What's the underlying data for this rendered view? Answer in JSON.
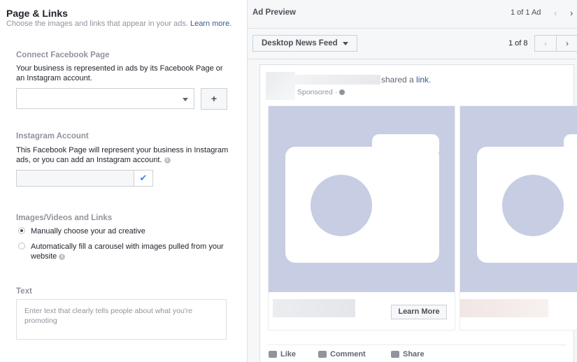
{
  "left": {
    "title": "Page & Links",
    "subtitle": "Choose the images and links that appear in your ads.",
    "learn_more": "Learn more.",
    "connect": {
      "label": "Connect Facebook Page",
      "desc": "Your business is represented in ads by its Facebook Page or an Instagram account.",
      "plus": "+"
    },
    "instagram": {
      "label": "Instagram Account",
      "desc": "This Facebook Page will represent your business in Instagram ads, or you can add an Instagram account.",
      "info": "i"
    },
    "media": {
      "label": "Images/Videos and Links",
      "option1": "Manually choose your ad creative",
      "option2_line1": "Automatically fill a carousel with images pulled from your",
      "option2_line2": "website",
      "info": "i"
    },
    "text": {
      "label": "Text",
      "placeholder": "Enter text that clearly tells people about what you're promoting"
    }
  },
  "right": {
    "title": "Ad Preview",
    "ad_count": "1 of 1 Ad",
    "prev_arrow": "‹",
    "next_arrow": "›",
    "placement": "Desktop News Feed",
    "page_count": "1 of 8",
    "card": {
      "shared_prefix": "shared a",
      "shared_link": "link",
      "shared_suffix": ".",
      "sponsored": "Sponsored ·",
      "learn_more_btn": "Learn More",
      "like": "Like",
      "comment": "Comment",
      "share": "Share"
    }
  },
  "colors": {
    "link": "#365899",
    "image_placeholder": "#c7cde2",
    "check": "#4080ff"
  }
}
